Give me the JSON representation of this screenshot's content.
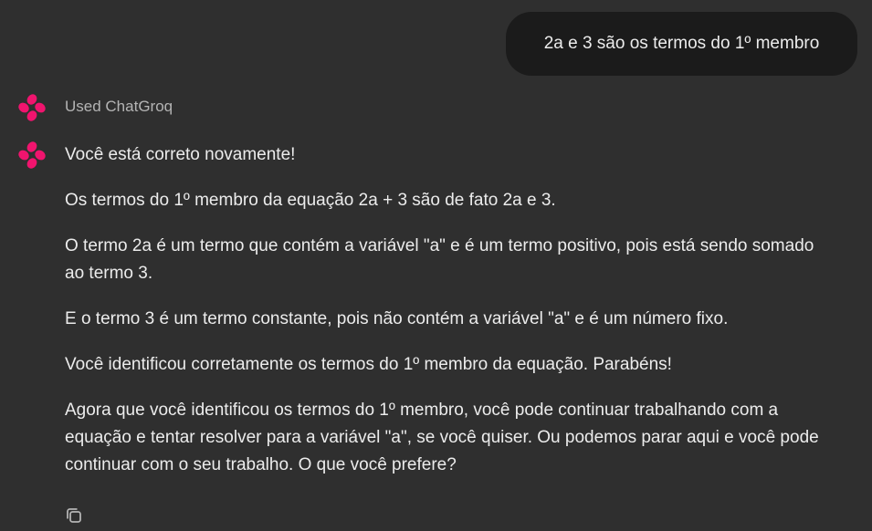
{
  "user_message": {
    "text": "2a e 3 são os termos do 1º membro"
  },
  "tool_use": {
    "label": "Used ChatGroq"
  },
  "assistant_message": {
    "paragraphs": [
      "Você está correto novamente!",
      "Os termos do 1º membro da equação 2a + 3 são de fato 2a e 3.",
      "O termo 2a é um termo que contém a variável \"a\" e é um termo positivo, pois está sendo somado ao termo 3.",
      "E o termo 3 é um termo constante, pois não contém a variável \"a\" e é um número fixo.",
      "Você identificou corretamente os termos do 1º membro da equação. Parabéns!",
      "Agora que você identificou os termos do 1º membro, você pode continuar trabalhando com a equação e tentar resolver para a variável \"a\", se você quiser. Ou podemos parar aqui e você pode continuar com o seu trabalho. O que você prefere?"
    ]
  },
  "icons": {
    "assistant_avatar": "groq-logo-icon",
    "copy": "copy-icon"
  },
  "colors": {
    "background": "#2f2f2f",
    "user_bubble": "#1b1b1b",
    "text": "#ececec",
    "muted_text": "#b4b4b4",
    "logo_accent": "#f0146e"
  }
}
